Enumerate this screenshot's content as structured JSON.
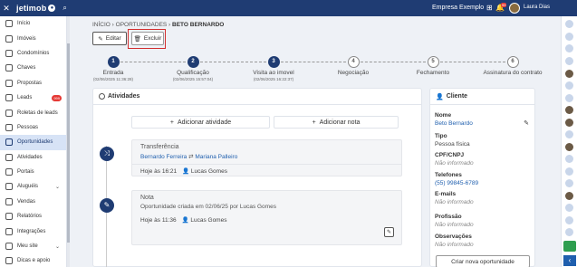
{
  "topbar": {
    "close_icon": "close-icon",
    "logo": "jetimob",
    "search_icon": "search-icon",
    "company": "Empresa Exemplo",
    "notification_badge": "99",
    "user_name": "Laura Dias"
  },
  "sidebar": {
    "items": [
      {
        "label": "Início",
        "icon": "home-icon"
      },
      {
        "label": "Imóveis",
        "icon": "building-icon"
      },
      {
        "label": "Condomínios",
        "icon": "condo-icon"
      },
      {
        "label": "Chaves",
        "icon": "key-icon"
      },
      {
        "label": "Propostas",
        "icon": "proposal-icon"
      },
      {
        "label": "Leads",
        "icon": "leads-icon",
        "badge": "999"
      },
      {
        "label": "Roletas de leads",
        "icon": "roulette-icon"
      },
      {
        "label": "Pessoas",
        "icon": "people-icon"
      },
      {
        "label": "Oportunidades",
        "icon": "opportunity-icon",
        "active": true
      },
      {
        "label": "Atividades",
        "icon": "activities-icon"
      },
      {
        "label": "Portais",
        "icon": "portal-icon"
      },
      {
        "label": "Aluguéis",
        "icon": "rent-icon",
        "chevron": "⌄"
      },
      {
        "label": "Vendas",
        "icon": "sales-icon"
      },
      {
        "label": "Relatórios",
        "icon": "report-icon"
      },
      {
        "label": "Integrações",
        "icon": "integration-icon"
      },
      {
        "label": "Meu site",
        "icon": "site-icon",
        "chevron": "⌄"
      },
      {
        "label": "Dicas e apoio",
        "icon": "help-icon"
      }
    ]
  },
  "breadcrumb": {
    "home": "INÍCIO",
    "sep1": " › ",
    "section": "OPORTUNIDADES",
    "sep2": " › ",
    "current": "BETO BERNARDO"
  },
  "actions": {
    "edit_label": "Editar",
    "delete_label": "Excluir"
  },
  "stepper": {
    "steps": [
      {
        "num": "1",
        "label": "Entrada",
        "date": "(02/06/2025 11:36:28)",
        "done": true
      },
      {
        "num": "2",
        "label": "Qualificação",
        "date": "(02/06/2025 15:57:04)",
        "done": true
      },
      {
        "num": "3",
        "label": "Visita ao imovel",
        "date": "(02/06/2025 16:22:37)",
        "done": true
      },
      {
        "num": "4",
        "label": "Negociação",
        "date": "",
        "done": false
      },
      {
        "num": "5",
        "label": "Fechamento",
        "date": "",
        "done": false
      },
      {
        "num": "6",
        "label": "Assinatura do contrato",
        "date": "",
        "done": false
      }
    ]
  },
  "activities": {
    "title": "Atividades",
    "add_activity": "Adicionar atividade",
    "add_note": "Adicionar nota",
    "items": [
      {
        "type": "Transferência",
        "from": "Bernardo Ferreira",
        "arrow": " ⇄ ",
        "to": "Mariana Palleiro",
        "time": "Hoje às 16:21",
        "user": "Lucas Gomes"
      },
      {
        "type": "Nota",
        "text": "Oportunidade criada em 02/06/25 por Lucas Gomes",
        "time": "Hoje às 11:36",
        "user": "Lucas Gomes"
      }
    ]
  },
  "client": {
    "title": "Cliente",
    "fields": [
      {
        "key": "Nome",
        "value": "Beto Bernardo",
        "style": "link"
      },
      {
        "key": "Tipo",
        "value": "Pessoa física",
        "style": ""
      },
      {
        "key": "CPF/CNPJ",
        "value": "Não informado",
        "style": "muted"
      },
      {
        "key": "Telefones",
        "value": "(55) 99845-6789",
        "style": "link"
      },
      {
        "key": "E-mails",
        "value": "Não informado",
        "style": "muted"
      },
      {
        "key": "Profissão",
        "value": "Não informado",
        "style": "muted"
      },
      {
        "key": "Observações",
        "value": "Não informado",
        "style": "muted"
      }
    ],
    "new_opportunity": "Criar nova oportunidade"
  }
}
